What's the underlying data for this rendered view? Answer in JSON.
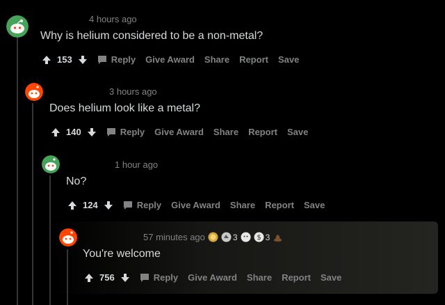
{
  "comments": [
    {
      "time": "4 hours ago",
      "text": "Why is helium considered to be a non-metal?",
      "votes": "153",
      "actions": {
        "reply": "Reply",
        "award": "Give Award",
        "share": "Share",
        "report": "Report",
        "save": "Save"
      }
    },
    {
      "time": "3 hours ago",
      "text": "Does helium look like a metal?",
      "votes": "140",
      "actions": {
        "reply": "Reply",
        "award": "Give Award",
        "share": "Share",
        "report": "Report",
        "save": "Save"
      }
    },
    {
      "time": "1 hour ago",
      "text": "No?",
      "votes": "124",
      "actions": {
        "reply": "Reply",
        "award": "Give Award",
        "share": "Share",
        "report": "Report",
        "save": "Save"
      }
    },
    {
      "time": "57 minutes ago",
      "text": "You're welcome",
      "votes": "756",
      "awards": [
        {
          "icon": "gold-award-icon",
          "count": ""
        },
        {
          "icon": "helpful-award-icon",
          "count": "3"
        },
        {
          "icon": "wholesome-award-icon",
          "count": ""
        },
        {
          "icon": "silver-award-icon",
          "count": "3"
        },
        {
          "icon": "poop-award-icon",
          "count": ""
        }
      ],
      "actions": {
        "reply": "Reply",
        "award": "Give Award",
        "share": "Share",
        "report": "Report",
        "save": "Save"
      }
    }
  ],
  "colors": {
    "background": "#000000",
    "text": "#d7dadc",
    "muted": "#818384",
    "thread_line": "#343536",
    "avatar_green": "#46a35a",
    "avatar_orange": "#ff4500"
  }
}
